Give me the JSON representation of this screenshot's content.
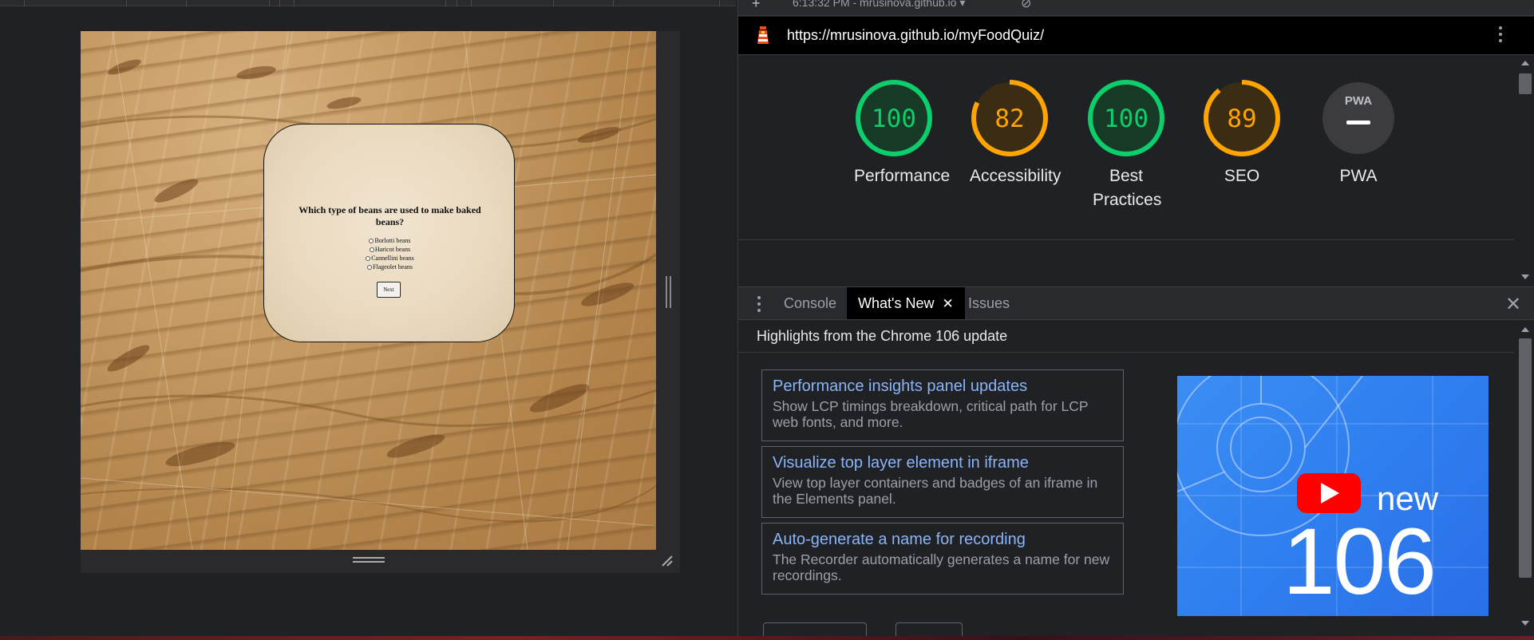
{
  "devtools_topbar": {
    "new_icon": "+",
    "report_label": "6:13:32 PM - mrusinova.github.io",
    "dropdown_icon": "▾",
    "blocked_icon": "⊘"
  },
  "url_bar": {
    "url": "https://mrusinova.github.io/myFoodQuiz/",
    "lighthouse_icon": "lighthouse-icon",
    "menu_icon": "more-vert-icon"
  },
  "quiz": {
    "question": "Which type of beans are used to make baked beans?",
    "options": [
      "Borlotti beans",
      "Haricot beans",
      "Cannellini beans",
      "Flageolet beans"
    ],
    "next_label": "Next"
  },
  "scores": [
    {
      "value": "100",
      "fraction": 1.0,
      "label": "Performance",
      "color": "#0cce6b",
      "bg": "#173a26"
    },
    {
      "value": "82",
      "fraction": 0.82,
      "label": "Accessibility",
      "color": "#ffa400",
      "bg": "#3a2d14"
    },
    {
      "value": "100",
      "fraction": 1.0,
      "label": "Best Practices",
      "color": "#0cce6b",
      "bg": "#173a26"
    },
    {
      "value": "89",
      "fraction": 0.89,
      "label": "SEO",
      "color": "#ffa400",
      "bg": "#3a2d14"
    },
    {
      "value": "PWA",
      "fraction": 0,
      "label": "PWA",
      "color": "#9aa0a6",
      "bg": "#3c3c3f"
    }
  ],
  "drawer": {
    "tabs": [
      "Console",
      "What's New",
      "Issues"
    ],
    "active_tab": "What's New",
    "close_icon": "✕",
    "tab_close_icon": "✕"
  },
  "whats_new": {
    "header": "Highlights from the Chrome 106 update",
    "items": [
      {
        "title": "Performance insights panel updates",
        "desc": "Show LCP timings breakdown, critical path for LCP web fonts, and more."
      },
      {
        "title": "Visualize top layer element in iframe",
        "desc": "View top layer containers and badges of an iframe in the Elements panel."
      },
      {
        "title": "Auto-generate a name for recording",
        "desc": "The Recorder automatically generates a name for new recordings."
      }
    ],
    "video": {
      "badge": "new",
      "version": "106"
    }
  }
}
